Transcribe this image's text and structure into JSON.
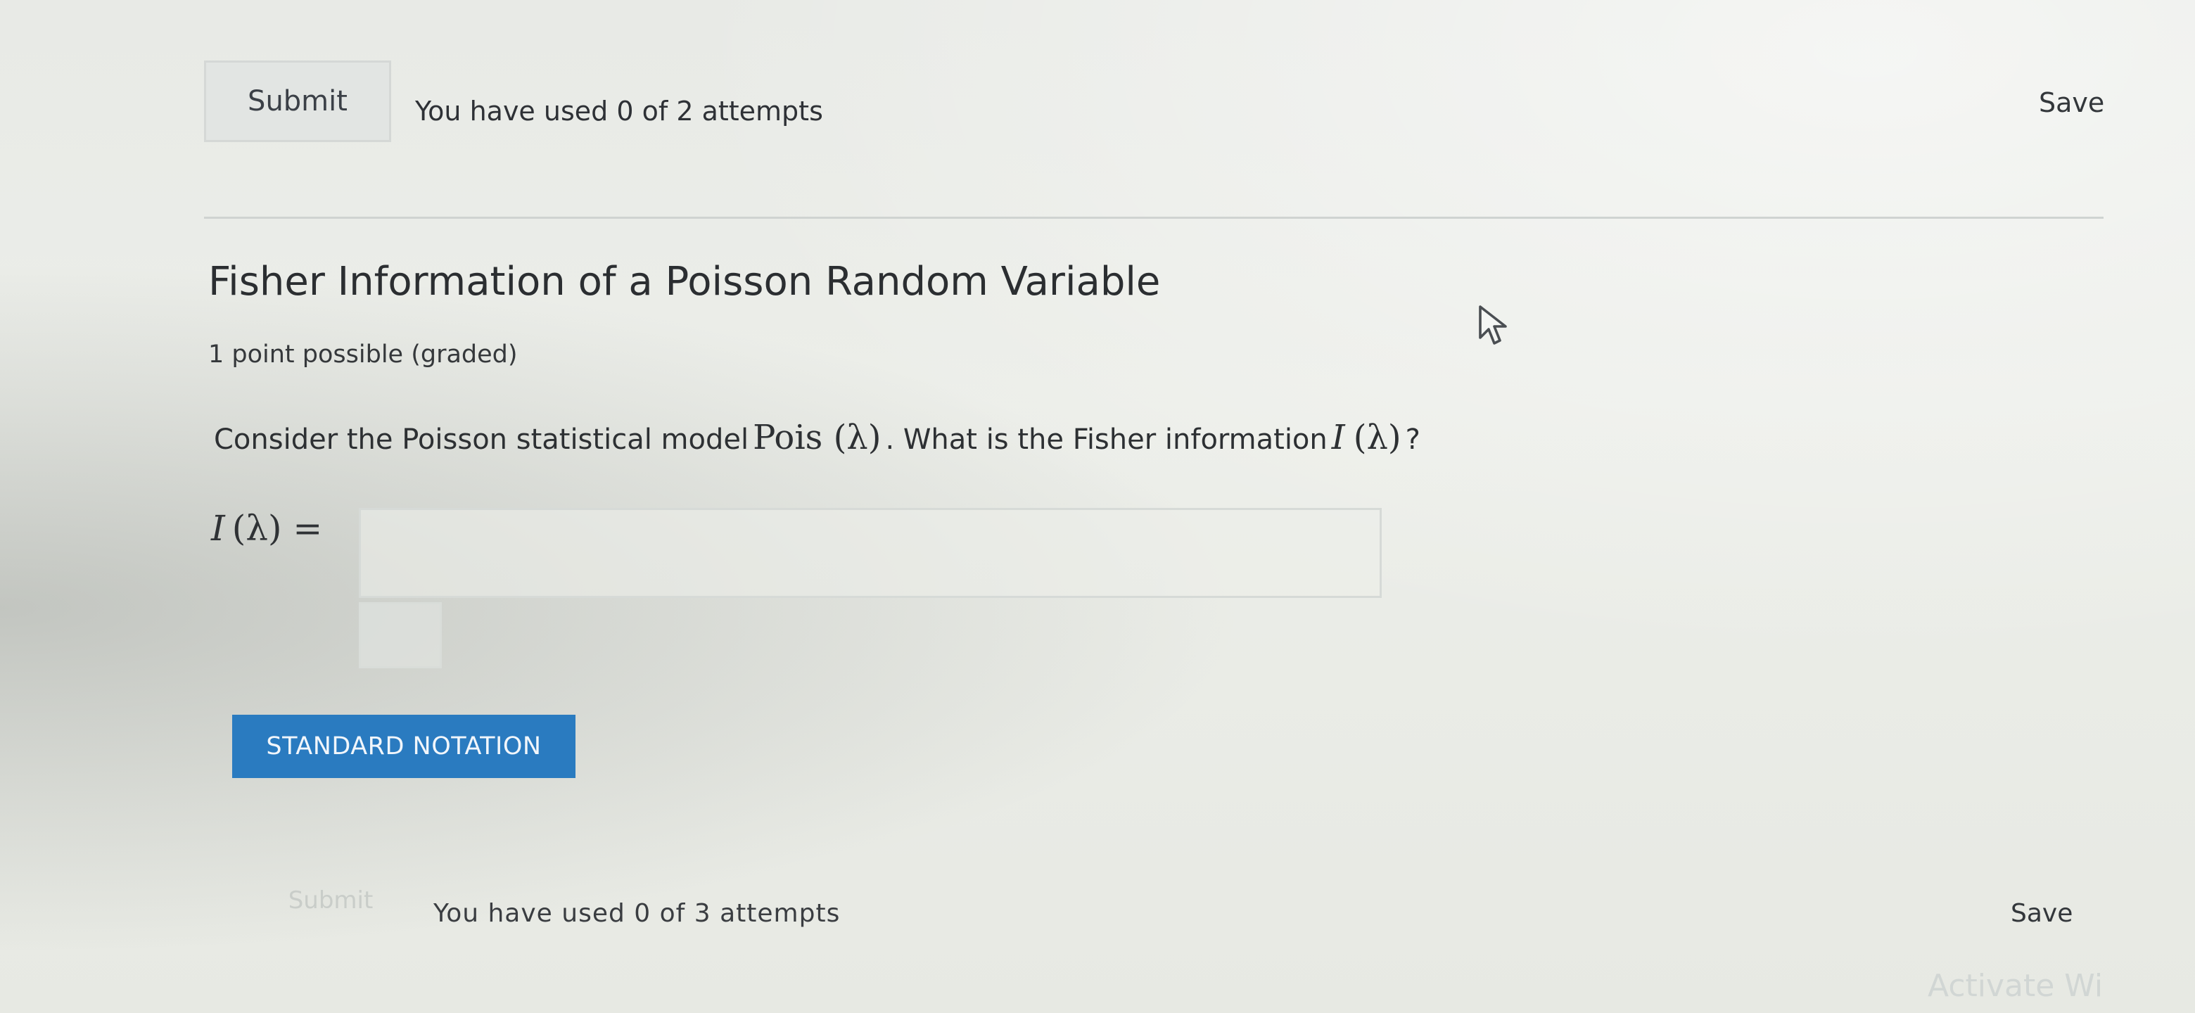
{
  "top_bar": {
    "submit_label": "Submit",
    "attempts_text": "You have used 0 of 2 attempts",
    "save_label": "Save"
  },
  "problem": {
    "title": "Fisher Information of a Poisson Random Variable",
    "points": "1 point possible (graded)",
    "question": {
      "prefix": "Consider the Poisson statistical model",
      "model_math": "Pois (λ)",
      "middle": ". What is the Fisher information",
      "info_math": "I",
      "info_arg": "(λ)",
      "suffix": "?"
    },
    "answer": {
      "label_symbol": "I",
      "label_rest": "(λ) =",
      "value": "",
      "placeholder": ""
    },
    "notation_button": "STANDARD NOTATION"
  },
  "bottom_bar": {
    "submit_label": "Submit",
    "attempts_text": "You have used 0 of 3 attempts",
    "save_label": "Save"
  },
  "watermark": "Activate Wi"
}
